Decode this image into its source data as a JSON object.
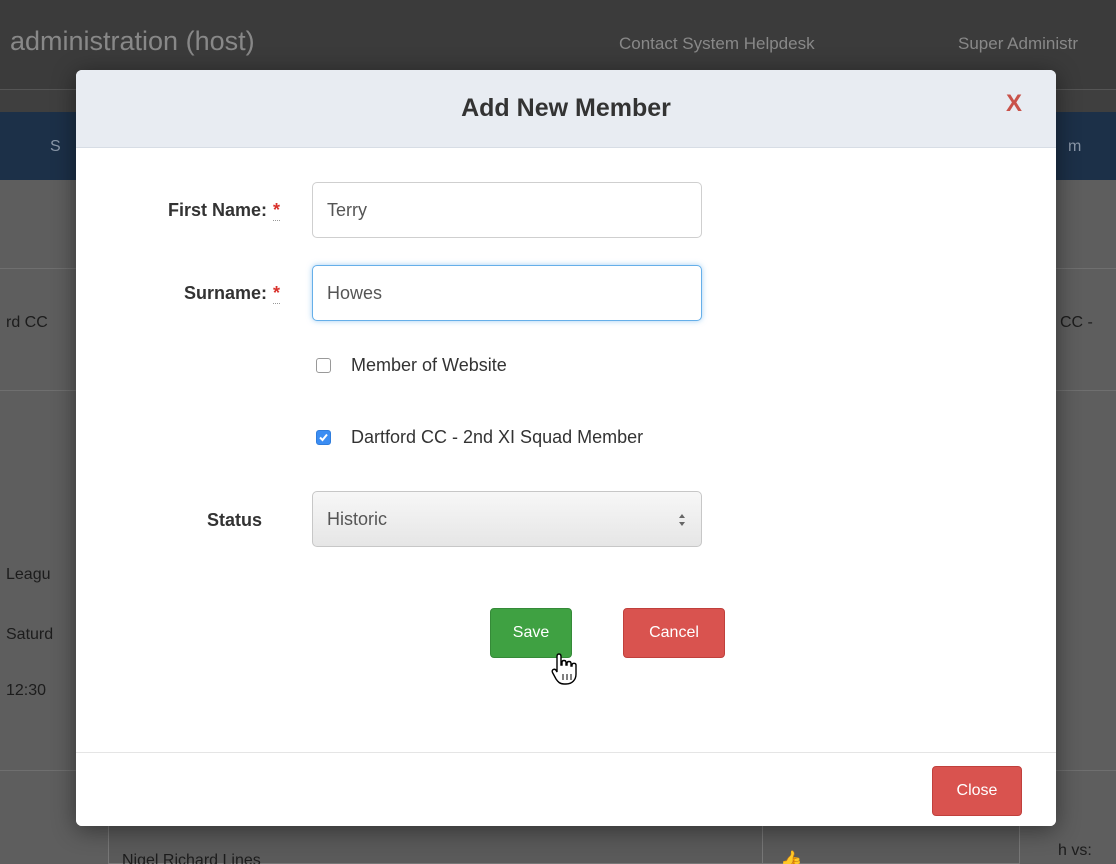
{
  "background": {
    "app_title": "administration (host)",
    "links": [
      "Contact System Helpdesk",
      "Super Administr"
    ],
    "nav_left": "S",
    "nav_right": "m",
    "row_left_1": "rd CC",
    "row_right_1": "CC -",
    "left_lines": [
      "Leagu",
      "Saturd",
      "12:30"
    ],
    "bottom_text": "Nigel Richard Lines",
    "bottom_right": "h vs:"
  },
  "modal": {
    "title": "Add New Member",
    "close_x": "X",
    "first_name": {
      "label": "First Name:",
      "required_mark": "*",
      "value": "Terry"
    },
    "surname": {
      "label": "Surname:",
      "required_mark": "*",
      "value": "Howes"
    },
    "checkboxes": [
      {
        "label": "Member of Website",
        "checked": false
      },
      {
        "label": "Dartford CC - 2nd XI Squad Member",
        "checked": true
      }
    ],
    "status": {
      "label": "Status",
      "selected": "Historic"
    },
    "buttons": {
      "save": "Save",
      "cancel": "Cancel",
      "close": "Close"
    }
  },
  "colors": {
    "save": "#3fa142",
    "cancel": "#d9534f",
    "checkbox_checked": "#3b8df3",
    "required": "#d9312b"
  }
}
